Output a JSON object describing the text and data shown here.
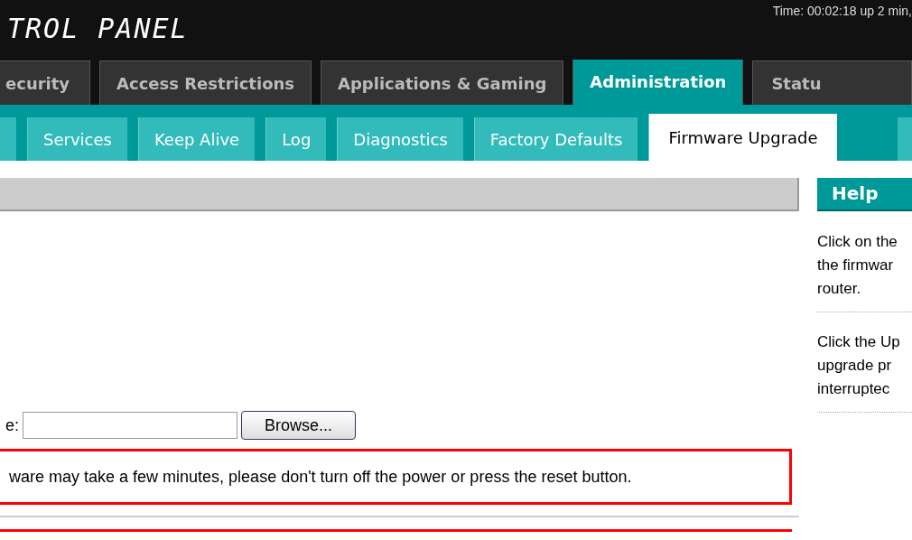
{
  "header": {
    "title": "TROL PANEL",
    "time": "Time: 00:02:18 up 2 min,"
  },
  "tabs": [
    {
      "label": "ecurity",
      "selected": false
    },
    {
      "label": "Access Restrictions",
      "selected": false
    },
    {
      "label": "Applications & Gaming",
      "selected": false
    },
    {
      "label": "Administration",
      "selected": true
    },
    {
      "label": "Statu",
      "selected": false
    }
  ],
  "subtabs": [
    {
      "label": "Services",
      "selected": false
    },
    {
      "label": "Keep Alive",
      "selected": false
    },
    {
      "label": "Log",
      "selected": false
    },
    {
      "label": "Diagnostics",
      "selected": false
    },
    {
      "label": "Factory Defaults",
      "selected": false
    },
    {
      "label": "Firmware Upgrade",
      "selected": true
    }
  ],
  "form": {
    "file_label": "e:",
    "browse_button": "Browse...",
    "warning": "ware may take a few minutes, please don't turn off the power or press the reset button."
  },
  "help": {
    "title": "Help",
    "paragraphs": [
      [
        "Click on the",
        "the firmwar",
        "router."
      ],
      [
        "Click the Up",
        "upgrade pr",
        "interruptec"
      ]
    ]
  }
}
